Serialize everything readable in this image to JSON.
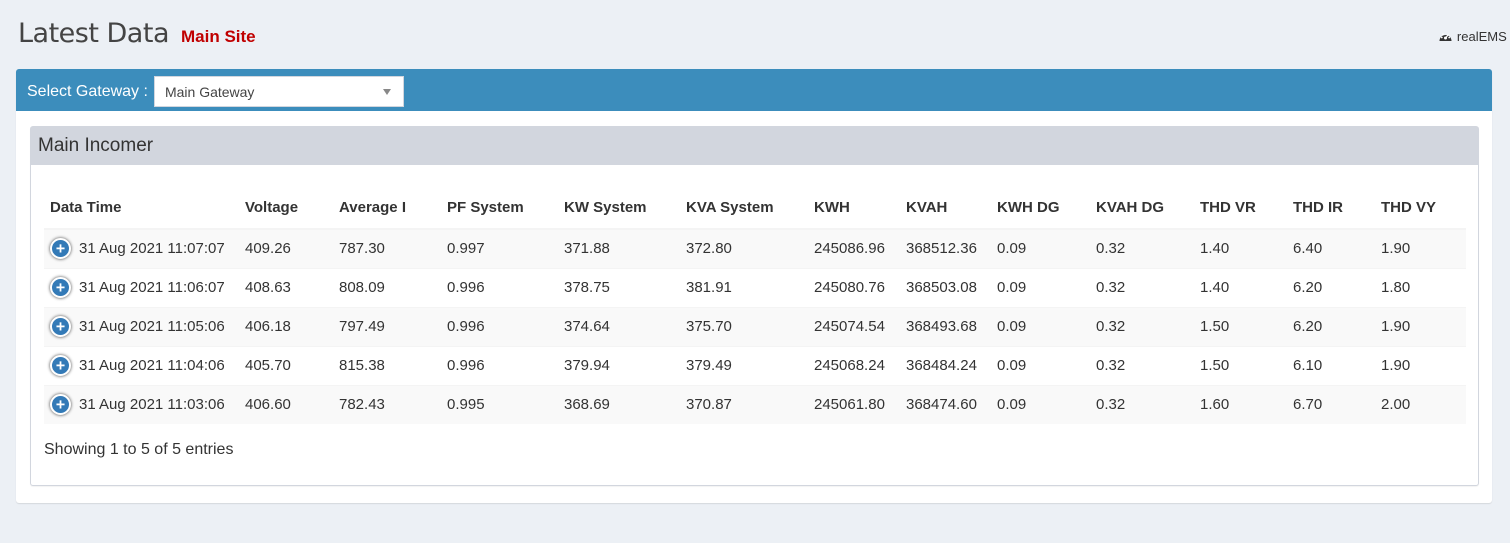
{
  "header": {
    "title": "Latest Data",
    "site": "Main Site",
    "breadcrumb": "realEMS :"
  },
  "gateway": {
    "label": "Select Gateway :",
    "selected": "Main Gateway"
  },
  "panel": {
    "title": "Main Incomer"
  },
  "table": {
    "columns": [
      "Data Time",
      "Voltage",
      "Average I",
      "PF System",
      "KW System",
      "KVA System",
      "KWH",
      "KVAH",
      "KWH DG",
      "KVAH DG",
      "THD VR",
      "THD IR",
      "THD VY"
    ],
    "rows": [
      [
        "31 Aug 2021 11:07:07",
        "409.26",
        "787.30",
        "0.997",
        "371.88",
        "372.80",
        "245086.96",
        "368512.36",
        "0.09",
        "0.32",
        "1.40",
        "6.40",
        "1.90"
      ],
      [
        "31 Aug 2021 11:06:07",
        "408.63",
        "808.09",
        "0.996",
        "378.75",
        "381.91",
        "245080.76",
        "368503.08",
        "0.09",
        "0.32",
        "1.40",
        "6.20",
        "1.80"
      ],
      [
        "31 Aug 2021 11:05:06",
        "406.18",
        "797.49",
        "0.996",
        "374.64",
        "375.70",
        "245074.54",
        "368493.68",
        "0.09",
        "0.32",
        "1.50",
        "6.20",
        "1.90"
      ],
      [
        "31 Aug 2021 11:04:06",
        "405.70",
        "815.38",
        "0.996",
        "379.94",
        "379.49",
        "245068.24",
        "368484.24",
        "0.09",
        "0.32",
        "1.50",
        "6.10",
        "1.90"
      ],
      [
        "31 Aug 2021 11:03:06",
        "406.60",
        "782.43",
        "0.995",
        "368.69",
        "370.87",
        "245061.80",
        "368474.60",
        "0.09",
        "0.32",
        "1.60",
        "6.70",
        "2.00"
      ]
    ],
    "expand_symbol": "+",
    "info": "Showing 1 to 5 of 5 entries"
  },
  "colors": {
    "primary": "#3c8dbc",
    "site_red": "#c00000",
    "background": "#ecf0f5",
    "panel_header": "#d2d6de",
    "expand_button": "#337ab7"
  },
  "icons": {
    "breadcrumb": "dashboard-icon",
    "dropdown": "chevron-down-icon",
    "row_expand": "plus-circle-icon"
  }
}
